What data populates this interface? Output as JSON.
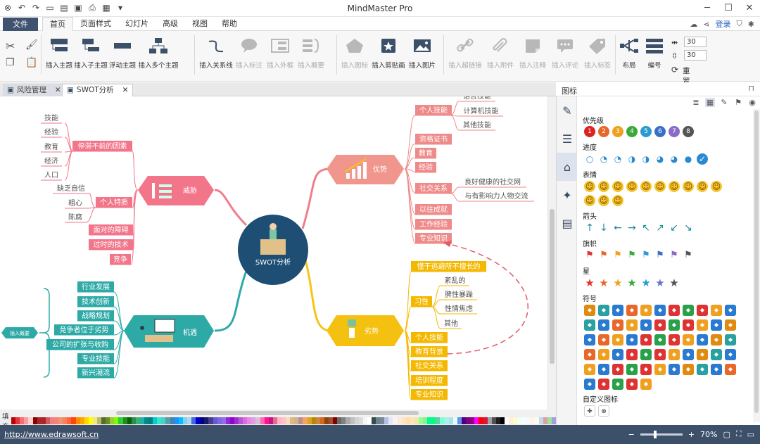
{
  "window": {
    "title": "MindMaster Pro",
    "login_label": "登录",
    "min_icon": "minimize-icon",
    "max_icon": "maximize-icon",
    "close_icon": "close-icon"
  },
  "menu": {
    "file_label": "文件",
    "tabs": [
      "首页",
      "页面样式",
      "幻灯片",
      "高级",
      "视图",
      "帮助"
    ],
    "active_tab": "首页"
  },
  "ribbon": {
    "insert_topic": "插入主题",
    "insert_subtopic": "插入子主题",
    "floating_topic": "浮动主题",
    "insert_multi_topic": "插入多个主题",
    "insert_relation": "插入关系线",
    "insert_callout": "插入标注",
    "insert_boundary": "插入外框",
    "insert_summary": "插入概要",
    "insert_icon": "插入图标",
    "insert_clipart": "插入剪贴画",
    "insert_image": "插入图片",
    "insert_hyperlink": "插入超链接",
    "insert_attachment": "插入附件",
    "insert_note": "插入注释",
    "insert_comment": "插入评论",
    "insert_tag": "插入标签",
    "layout": "布局",
    "numbering": "编号",
    "spacing_h": "30",
    "spacing_v": "30",
    "reset": "重置"
  },
  "doc_tabs": [
    {
      "label": "风险管理",
      "active": false
    },
    {
      "label": "SWOT分析",
      "active": true
    }
  ],
  "canvas": {
    "center": "SWOT分析",
    "strengths": {
      "label": "优势",
      "items": [
        "个人技能",
        "资格证书",
        "教育",
        "经验",
        "社交关系",
        "以往成就",
        "工作经验",
        "专业知识"
      ],
      "skills_sub": [
        "语言技能",
        "计算机技能",
        "其他技能"
      ],
      "social_sub": [
        "良好健康的社交网",
        "与有影响力人物交流"
      ]
    },
    "threats": {
      "label": "威胁",
      "items": [
        "停滞不前的因素",
        "个人特质",
        "面对的障碍",
        "过时的技术",
        "竞争"
      ],
      "stagnation_sub": [
        "技能",
        "经验",
        "教育",
        "经济",
        "人口"
      ],
      "traits_sub": [
        "缺乏自信",
        "粗心",
        "陈腐"
      ]
    },
    "weaknesses": {
      "label": "劣势",
      "items": [
        "懂于逃避所不擅长的",
        "习性",
        "个人技能",
        "教育背景",
        "社交关系",
        "培训程度",
        "专业知识"
      ],
      "habits_sub": [
        "紊乱的",
        "脾性暴躁",
        "性情焦虑",
        "其他"
      ]
    },
    "opportunities": {
      "label": "机遇",
      "items": [
        "行业发展",
        "技术创新",
        "战略规划",
        "竞争者位于劣势",
        "公司的扩张与收购",
        "专业技能",
        "新兴潮流"
      ],
      "summary": "插入概要"
    }
  },
  "colorbar": {
    "label": "填充",
    "colors": [
      "#c00000",
      "#e0383c",
      "#ff6a6a",
      "#f4a0a0",
      "#ffd0d0",
      "#8b0000",
      "#a52a2a",
      "#b22222",
      "#cd5c5c",
      "#f08080",
      "#fa8072",
      "#e9967a",
      "#ff7f50",
      "#ff6347",
      "#ff4500",
      "#ff8c00",
      "#ffa500",
      "#ffd700",
      "#ffff00",
      "#f0e68c",
      "#bdb76b",
      "#556b2f",
      "#6b8e23",
      "#9acd32",
      "#7cfc00",
      "#32cd32",
      "#228b22",
      "#006400",
      "#2e8b57",
      "#3cb371",
      "#20b2aa",
      "#008b8b",
      "#008080",
      "#00ced1",
      "#40e0d0",
      "#48d1cc",
      "#5f9ea0",
      "#4682b4",
      "#1e90ff",
      "#00bfff",
      "#87ceeb",
      "#add8e6",
      "#4169e1",
      "#0000cd",
      "#00008b",
      "#191970",
      "#483d8b",
      "#6a5acd",
      "#7b68ee",
      "#9370db",
      "#8a2be2",
      "#9400d3",
      "#9932cc",
      "#ba55d3",
      "#da70d6",
      "#ee82ee",
      "#dda0dd",
      "#d8bfd8",
      "#ff69b4",
      "#ff1493",
      "#c71585",
      "#db7093",
      "#ffb6c1",
      "#ffc0cb",
      "#f5deb3",
      "#deb887",
      "#d2b48c",
      "#bc8f8f",
      "#f4a460",
      "#daa520",
      "#b8860b",
      "#cd853f",
      "#d2691e",
      "#8b4513",
      "#a0522d",
      "#800000",
      "#696969",
      "#808080",
      "#a9a9a9",
      "#c0c0c0",
      "#d3d3d3",
      "#dcdcdc",
      "#f5f5f5",
      "#ffffff",
      "#2f4f4f",
      "#708090",
      "#778899",
      "#b0c4de",
      "#e6e6fa",
      "#fff0f5",
      "#faebd7",
      "#ffe4c4",
      "#ffdead",
      "#ffe4b5",
      "#eee8aa",
      "#98fb98",
      "#90ee90",
      "#00fa9a",
      "#00ff7f",
      "#66cdaa",
      "#7fffd4",
      "#afeeee",
      "#b0e0e6",
      "#e0ffff",
      "#6495ed",
      "#4b0082",
      "#800080",
      "#8b008b",
      "#ff00ff",
      "#ff0000",
      "#dc143c",
      "#a0a0a0",
      "#505050",
      "#202020",
      "#000000",
      "#fefefe",
      "#ffefd5",
      "#fffacd",
      "#f0fff0",
      "#f0ffff",
      "#f8f8ff",
      "#fdf5e6",
      "#fffaf0",
      "#c0d8f0",
      "#e0a0a0",
      "#a0e0a0",
      "#a0a0e0"
    ]
  },
  "status": {
    "url": "http://www.edrawsoft.cn",
    "zoom": "70%",
    "zoom_level": 0.35
  },
  "panel": {
    "title": "图标",
    "categories": [
      "优先级",
      "进度",
      "表情",
      "箭头",
      "旗帜",
      "星",
      "符号",
      "自定义图标"
    ],
    "priority_numbers": [
      "1",
      "2",
      "3",
      "4",
      "5",
      "6",
      "7",
      "8"
    ],
    "priority_colors": [
      "#d22",
      "#e8672a",
      "#f0a020",
      "#3aa83a",
      "#2a9ad0",
      "#3a6fc8",
      "#8a6bc8",
      "#555"
    ],
    "flag_colors": [
      "#d33",
      "#e8672a",
      "#f0a020",
      "#3aa83a",
      "#2a9ad0",
      "#3a6fc8",
      "#8a6bc8",
      "#555"
    ],
    "star_colors": [
      "#d33",
      "#e8672a",
      "#f0a020",
      "#3aa83a",
      "#2a9ad0",
      "#6a6fd8",
      "#555"
    ],
    "arrows": [
      "↑",
      "↓",
      "←",
      "→",
      "↖",
      "↗",
      "↙",
      "↘"
    ]
  }
}
